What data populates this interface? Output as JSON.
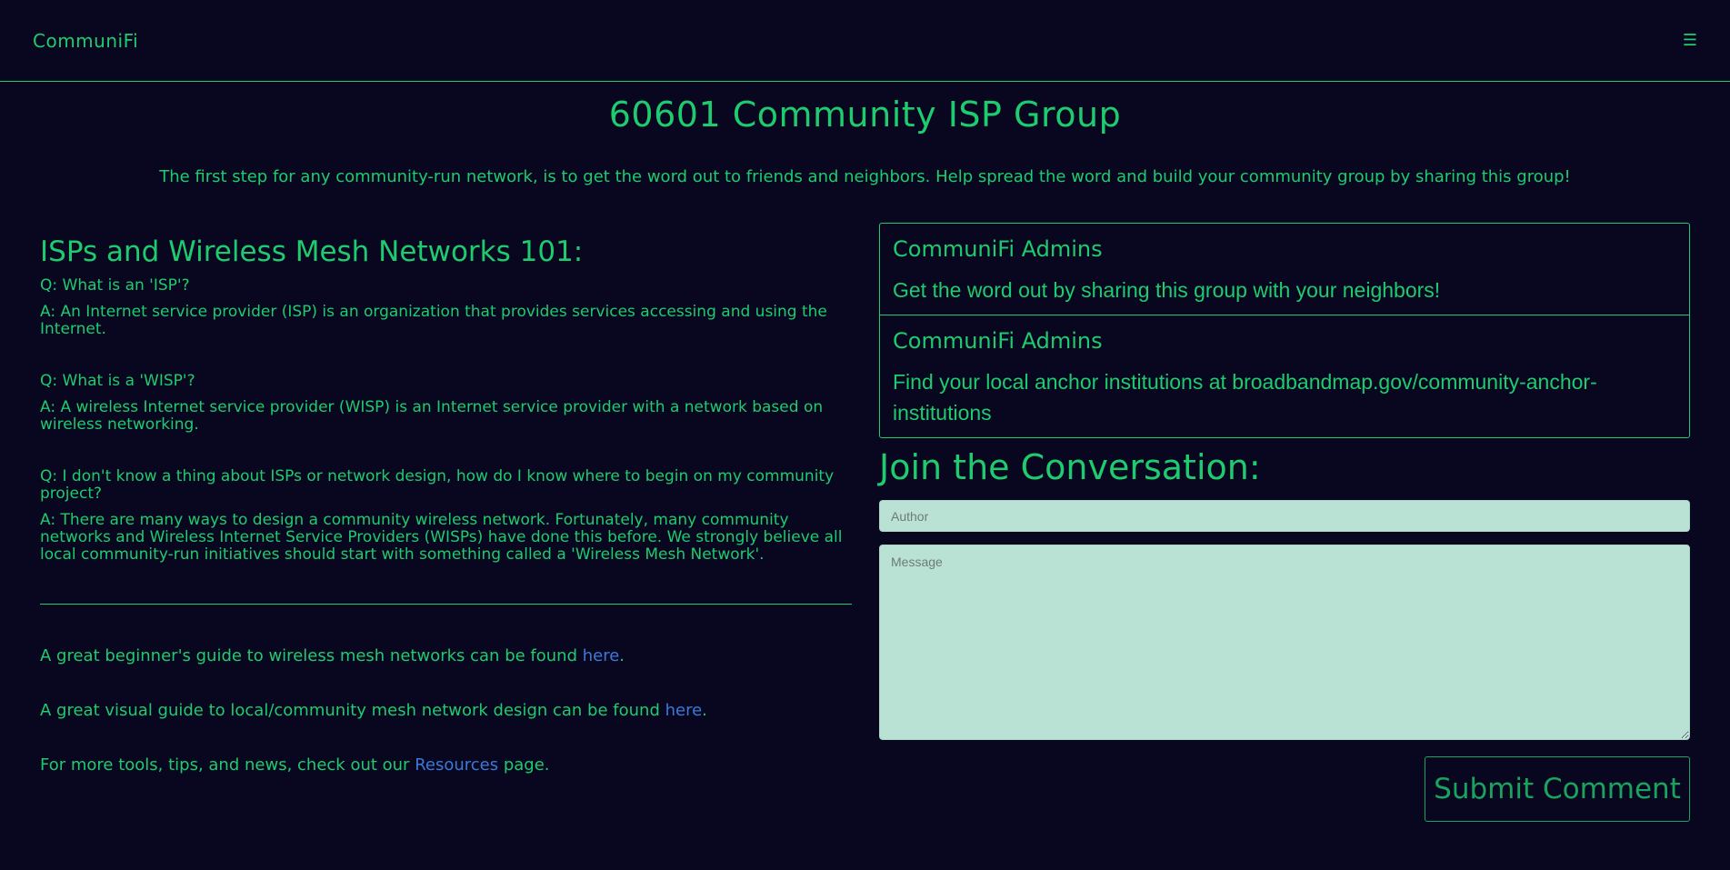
{
  "nav": {
    "brand": "CommuniFi",
    "menu_icon": "☰"
  },
  "page": {
    "title": "60601 Community ISP Group",
    "intro": "The first step for any community-run network, is to get the word out to friends and neighbors. Help spread the word and build your community group by sharing this group!"
  },
  "faq": {
    "title": "ISPs and Wireless Mesh Networks 101:",
    "items": [
      {
        "q": "Q: What is an 'ISP'?",
        "a": "A: An Internet service provider (ISP) is an organization that provides services accessing and using the Internet."
      },
      {
        "q": "Q: What is a 'WISP'?",
        "a": "A: A wireless Internet service provider (WISP) is an Internet service provider with a network based on wireless networking."
      },
      {
        "q": "Q: I don't know a thing about ISPs or network design, how do I know where to begin on my community project?",
        "a": "A: There are many ways to design a community wireless network. Fortunately, many community networks and Wireless Internet Service Providers (WISPs) have done this before. We strongly believe all local community-run initiatives should start with something called a 'Wireless Mesh Network'."
      }
    ]
  },
  "guides": [
    {
      "text": "A great beginner's guide to wireless mesh networks can be found ",
      "link": "here",
      "after": "."
    },
    {
      "text": "A great visual guide to local/community mesh network design can be found ",
      "link": "here",
      "after": "."
    },
    {
      "text": "For more tools, tips, and news, check out our ",
      "link": "Resources",
      "after": " page."
    }
  ],
  "admin_posts": [
    {
      "author": "CommuniFi Admins",
      "message": "Get the word out by sharing this group with your neighbors!"
    },
    {
      "author": "CommuniFi Admins",
      "message": "Find your local anchor institutions at broadbandmap.gov/community-anchor-institutions"
    }
  ],
  "comment_form": {
    "title": "Join the Conversation:",
    "author_placeholder": "Author",
    "message_placeholder": "Message",
    "submit_label": "Submit Comment"
  },
  "colors": {
    "background": "#08071f",
    "accent": "#1ecb6e",
    "link": "#3d78d8",
    "input_bg": "#b9e2d5"
  }
}
